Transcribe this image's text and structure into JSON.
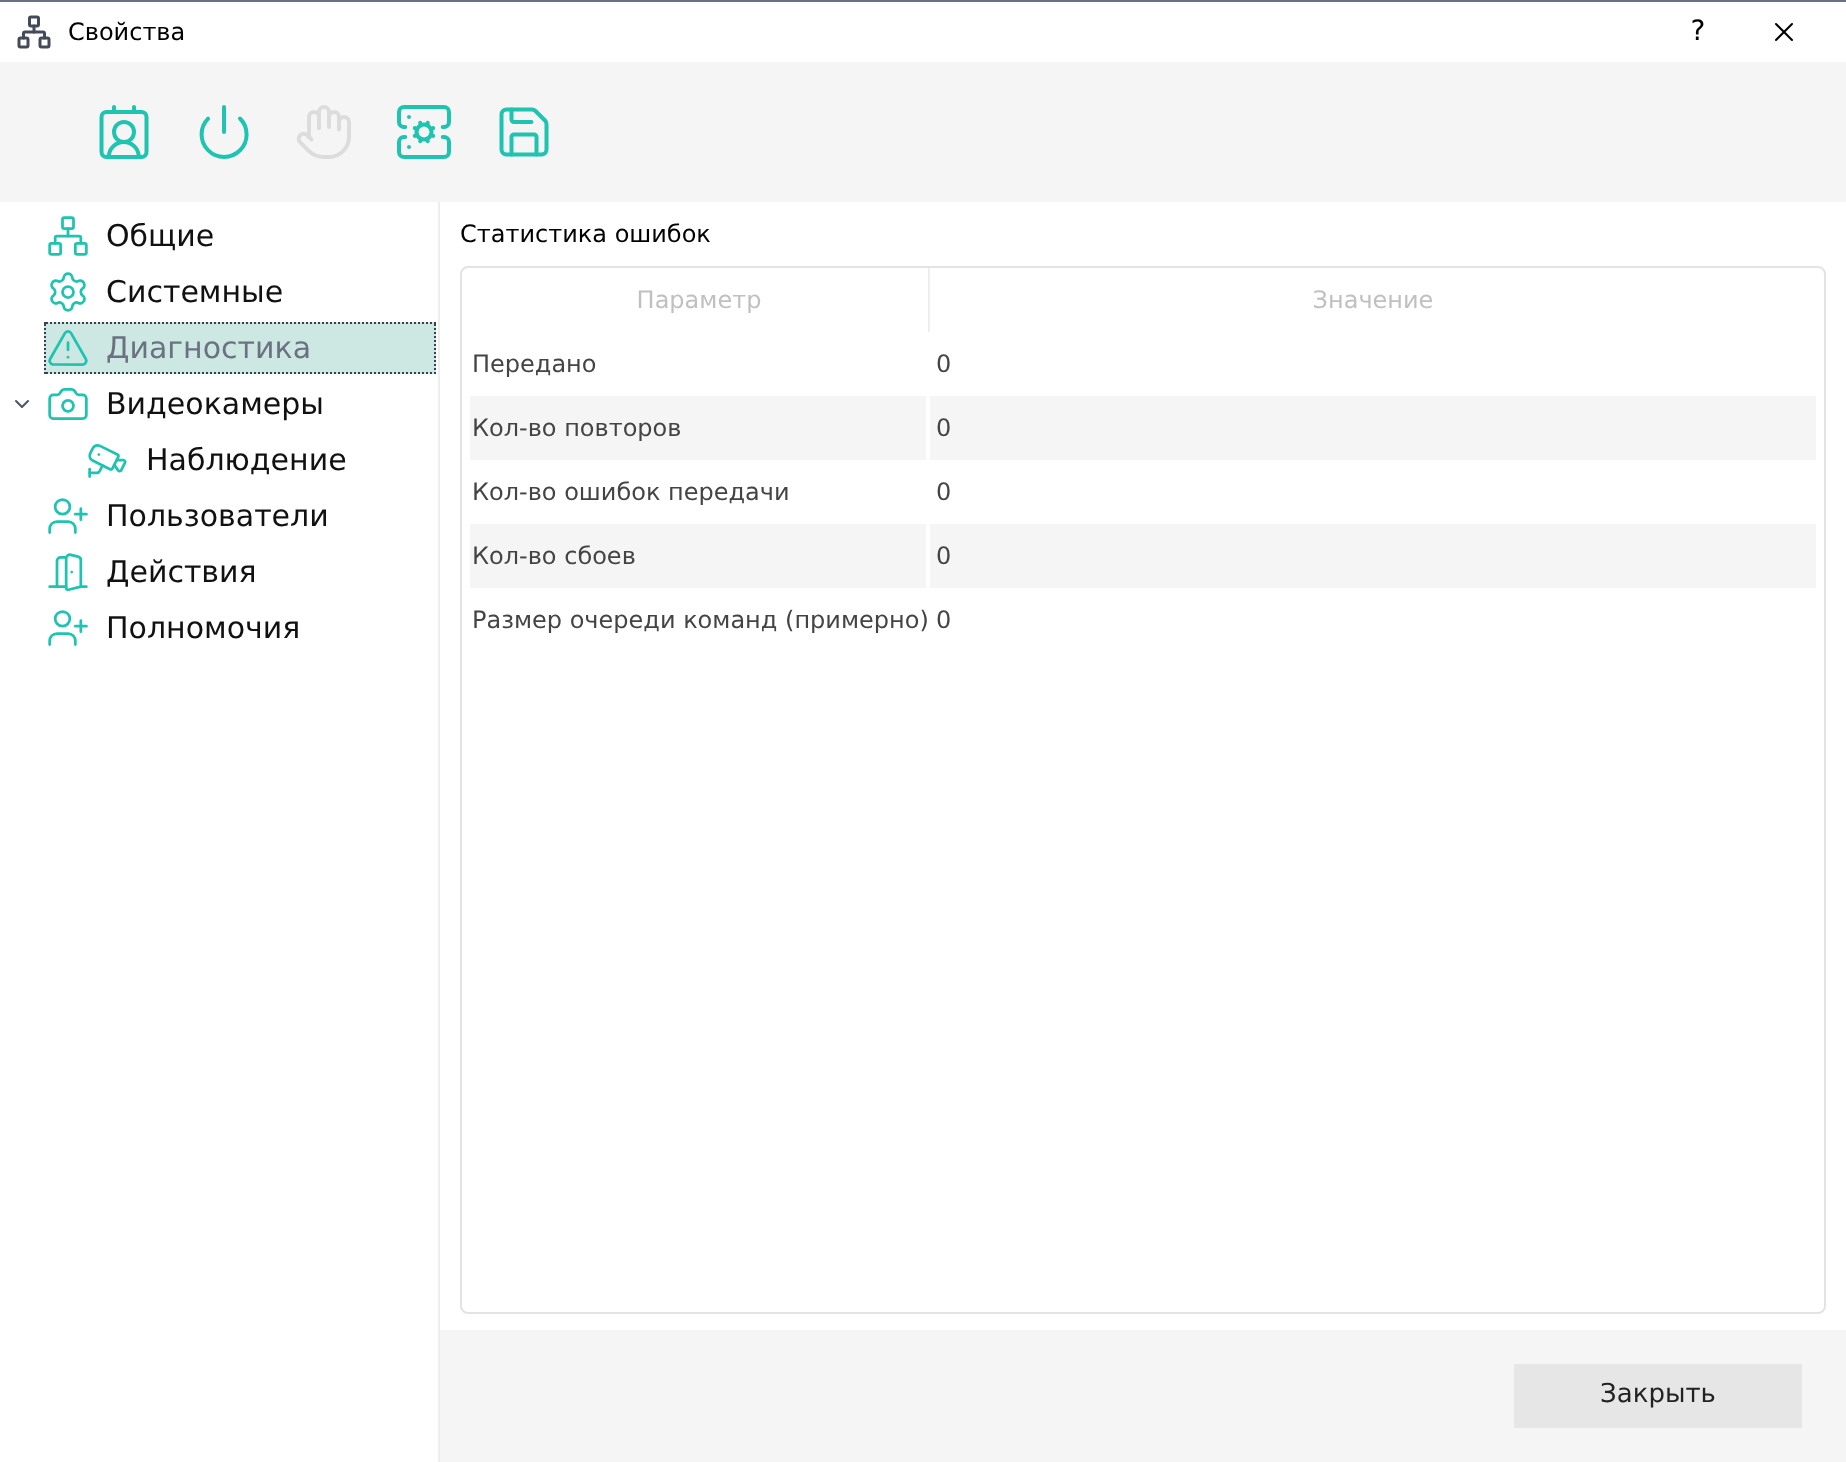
{
  "window": {
    "title": "Свойства",
    "help": "?"
  },
  "toolbar": [
    {
      "disabled": false
    },
    {
      "disabled": false
    },
    {
      "disabled": true
    },
    {
      "disabled": false
    },
    {
      "disabled": false
    }
  ],
  "sidebar": {
    "items": [
      {
        "label": "Общие",
        "selected": false
      },
      {
        "label": "Системные",
        "selected": false
      },
      {
        "label": "Диагностика",
        "selected": true
      },
      {
        "label": "Видеокамеры",
        "selected": false,
        "expanded": true,
        "children": [
          {
            "label": "Наблюдение",
            "selected": false
          }
        ]
      },
      {
        "label": "Пользователи",
        "selected": false
      },
      {
        "label": "Действия",
        "selected": false
      },
      {
        "label": "Полномочия",
        "selected": false
      }
    ]
  },
  "section_title": "Статистика ошибок",
  "table": {
    "columns": [
      "Параметр",
      "Значение"
    ],
    "rows": [
      [
        "Передано",
        "0"
      ],
      [
        "Кол-во повторов",
        "0"
      ],
      [
        "Кол-во ошибок передачи",
        "0"
      ],
      [
        "Кол-во сбоев",
        "0"
      ],
      [
        "Размер очереди команд (примерно)",
        "0"
      ]
    ]
  },
  "buttons": [
    "Закрыть"
  ]
}
